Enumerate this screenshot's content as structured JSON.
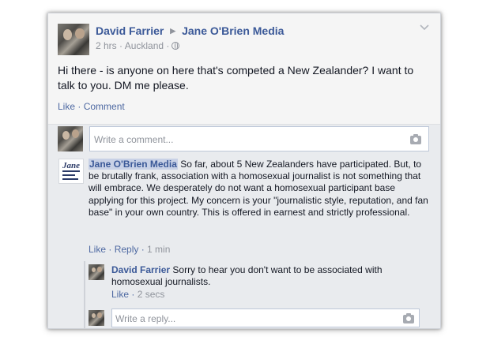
{
  "post": {
    "author": "David Farrier",
    "target": "Jane O'Brien Media",
    "time": "2 hrs",
    "location": "Auckland",
    "text": "Hi there - is anyone on here that's competed a New Zealander? I want to talk to you. DM me please.",
    "like_label": "Like",
    "comment_label": "Comment"
  },
  "composer": {
    "placeholder": "Write a comment..."
  },
  "reply": {
    "author": "Jane O'Brien Media",
    "text": "So far, about 5 New Zealanders have participated. But, to be brutally frank, association with a homosexual journalist is not something that will embrace. We desperately do not want a homosexual participant base applying for this project. My concern is your \"journalistic style, reputation, and fan base\" in your own country. This is offered in earnest and strictly professional.",
    "like_label": "Like",
    "reply_label": "Reply",
    "time": "1 min"
  },
  "subreply": {
    "author": "David Farrier",
    "text": "Sorry to hear you don't want to be associated with homosexual journalists.",
    "like_label": "Like",
    "time": "2 secs"
  },
  "reply_composer": {
    "placeholder": "Write a reply..."
  },
  "colors": {
    "link": "#3b5998",
    "background": "#e9ebee",
    "highlight": "#c8d1e6"
  }
}
